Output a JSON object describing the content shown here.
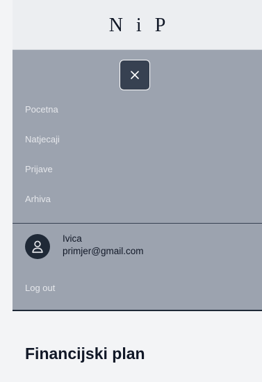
{
  "header": {
    "brand": "N i P"
  },
  "drawer": {
    "close_icon": "close-icon",
    "nav": {
      "items": [
        {
          "label": "Pocetna"
        },
        {
          "label": "Natjecaji"
        },
        {
          "label": "Prijave"
        },
        {
          "label": "Arhiva"
        }
      ]
    },
    "user": {
      "avatar_icon": "user-icon",
      "name": "Ivica",
      "email": "primjer@gmail.com"
    },
    "logout_label": "Log out"
  },
  "main": {
    "title": "Financijski plan"
  },
  "colors": {
    "drawer_bg": "#9ca3af",
    "close_button_bg": "#374151",
    "avatar_bg": "#1f2937",
    "nav_text": "#e5e7eb"
  }
}
